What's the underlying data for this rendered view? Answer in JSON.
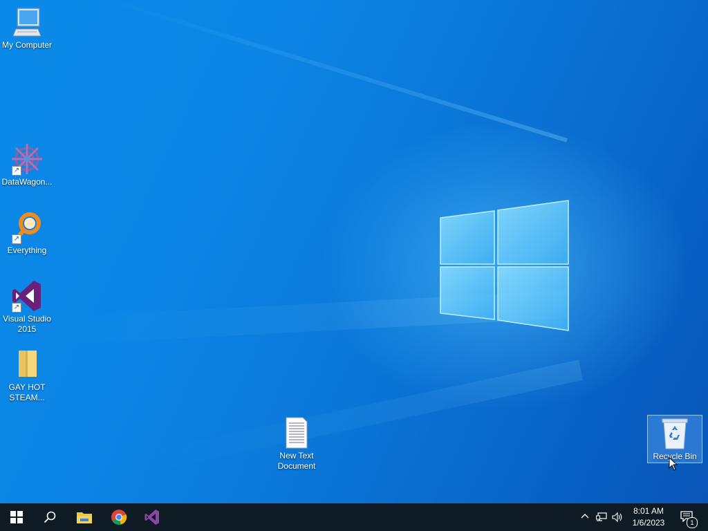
{
  "desktop": {
    "icons": [
      {
        "name": "my-computer",
        "label": "My Computer",
        "icon": "computer-icon"
      },
      {
        "name": "datawagon",
        "label": "DataWagon...",
        "icon": "datawagon-icon"
      },
      {
        "name": "everything",
        "label": "Everything",
        "icon": "everything-search-icon"
      },
      {
        "name": "visual-studio",
        "label": "Visual Studio 2015",
        "icon": "visual-studio-icon"
      },
      {
        "name": "folder",
        "label": "GAY HOT STEAM...",
        "icon": "folder-icon"
      },
      {
        "name": "new-text-document",
        "label": "New Text Document",
        "icon": "text-document-icon"
      },
      {
        "name": "recycle-bin",
        "label": "Recycle Bin",
        "icon": "recycle-bin-icon"
      }
    ]
  },
  "taskbar": {
    "start": "start-icon",
    "search": "search-icon",
    "pinned": [
      "file-explorer-icon",
      "chrome-icon",
      "visual-studio-icon"
    ],
    "tray": {
      "time": "8:01 AM",
      "date": "1/6/2023",
      "notification_count": "1"
    }
  },
  "colors": {
    "wallpaper": "#0a80e0",
    "taskbar": "#0e1a24",
    "vs_purple": "#68217a"
  }
}
